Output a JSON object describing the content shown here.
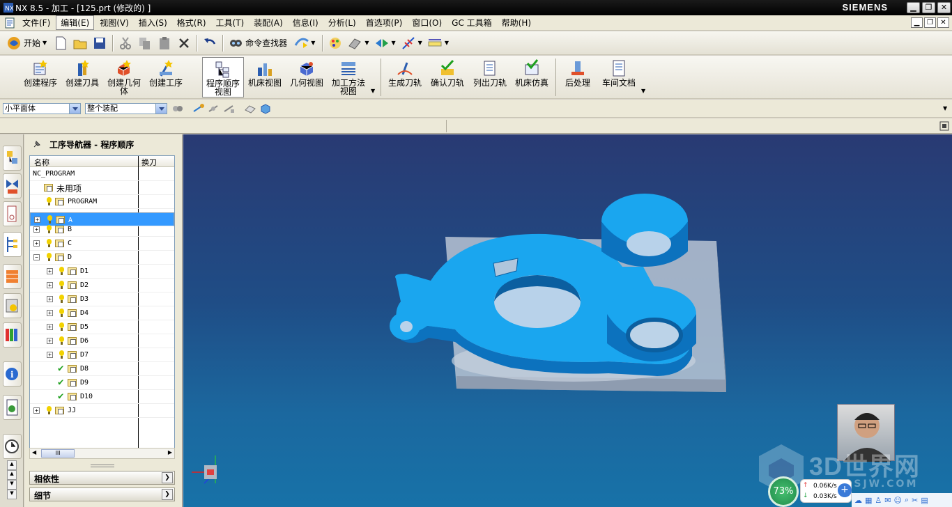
{
  "window": {
    "title": "NX 8.5 - 加工 - [125.prt (修改的) ]",
    "brand": "SIEMENS"
  },
  "menu": [
    "文件(F)",
    "编辑(E)",
    "视图(V)",
    "插入(S)",
    "格式(R)",
    "工具(T)",
    "装配(A)",
    "信息(I)",
    "分析(L)",
    "首选项(P)",
    "窗口(O)",
    "GC 工具箱",
    "帮助(H)"
  ],
  "toolbar1": {
    "start_label": "开始",
    "command_finder_label": "命令查找器"
  },
  "toolbar2": [
    {
      "label": "创建程序"
    },
    {
      "label": "创建刀具"
    },
    {
      "label": "创建几何体"
    },
    {
      "label": "创建工序"
    },
    {
      "label": "程序顺序视图"
    },
    {
      "label": "机床视图"
    },
    {
      "label": "几何视图"
    },
    {
      "label": "加工方法视图"
    },
    {
      "label": "生成刀轨"
    },
    {
      "label": "确认刀轨"
    },
    {
      "label": "列出刀轨"
    },
    {
      "label": "机床仿真"
    },
    {
      "label": "后处理"
    },
    {
      "label": "车间文档"
    }
  ],
  "selection": {
    "filter": "小平面体",
    "scope": "整个装配"
  },
  "navigator": {
    "title": "工序导航器 - 程序顺序",
    "col_name": "名称",
    "col_tool": "换刀",
    "rows": [
      "NC_PROGRAM",
      "未用项",
      "PROGRAM",
      "A",
      "B",
      "C",
      "D",
      "D1",
      "D2",
      "D3",
      "D4",
      "D5",
      "D6",
      "D7",
      "D8",
      "D9",
      "D10",
      "JJ"
    ],
    "scroll_grip": "III",
    "dependency_label": "相依性",
    "details_label": "细节"
  },
  "watermark": {
    "brand": "3D世界网",
    "url": "3DSJW.COM"
  },
  "netmeter": {
    "percent": "73%",
    "up": "0.06K/s",
    "down": "0.03K/s"
  }
}
